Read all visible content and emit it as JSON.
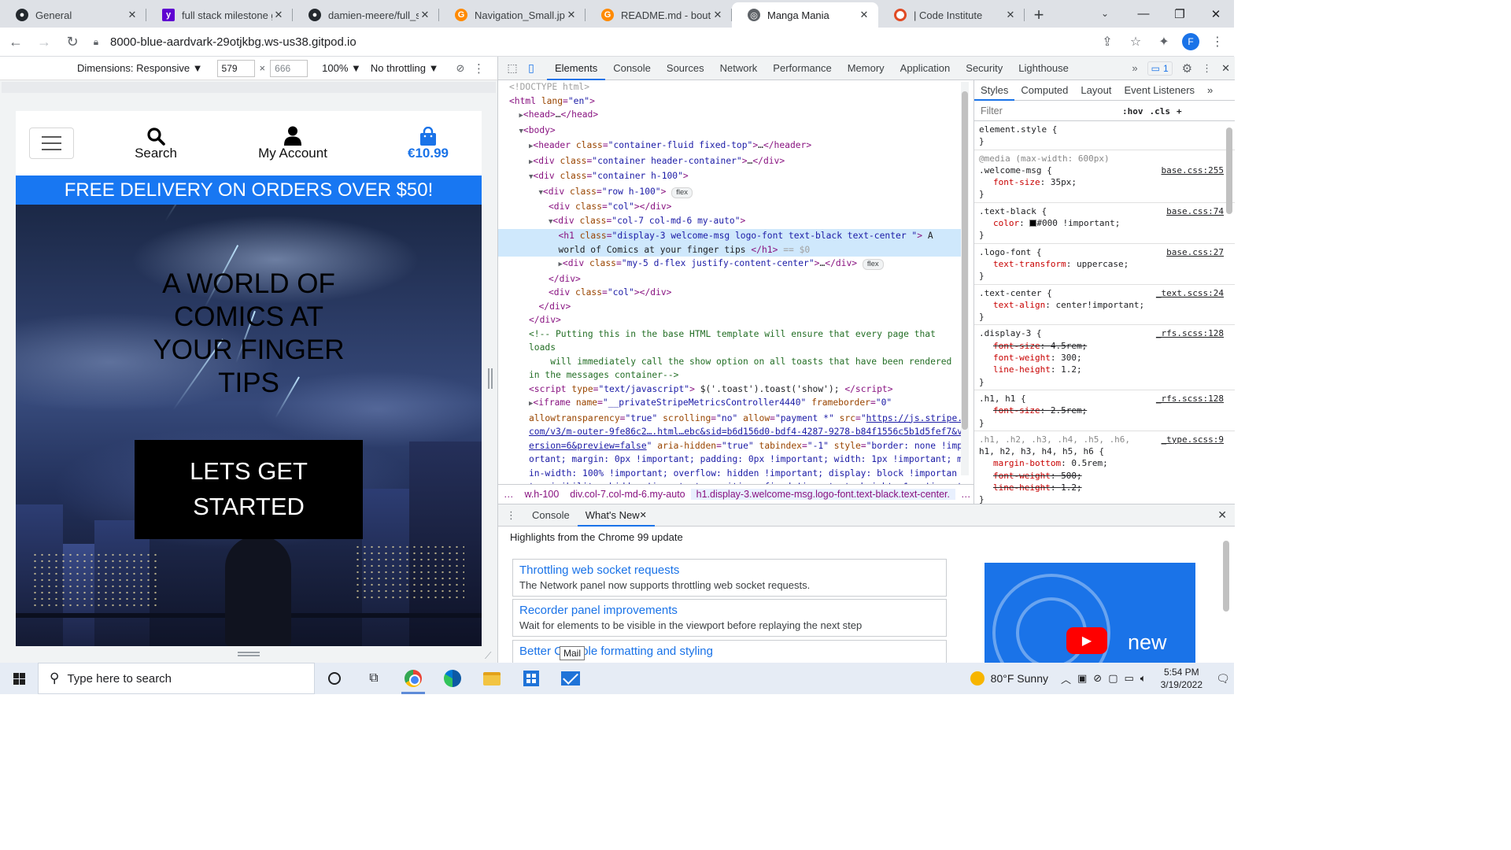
{
  "tabs": [
    {
      "title": "General",
      "favicon": "github-icon",
      "active": false
    },
    {
      "title": "full stack milestone gi",
      "favicon": "yahoo-icon",
      "active": false
    },
    {
      "title": "damien-meere/full_st",
      "favicon": "github-icon",
      "active": false
    },
    {
      "title": "Navigation_Small.jpg",
      "favicon": "gitpod-icon",
      "active": false
    },
    {
      "title": "README.md - boutiq",
      "favicon": "gitpod-icon",
      "active": false
    },
    {
      "title": "Manga Mania",
      "favicon": "globe-icon",
      "active": true
    },
    {
      "title": "| Code Institute",
      "favicon": "code-institute-icon",
      "active": false
    }
  ],
  "window_controls": {
    "minimize": "—",
    "maximize": "❐",
    "close": "✕"
  },
  "omnibox": {
    "url": "8000-blue-aardvark-29otjkbg.ws-us38.gitpod.io",
    "profile_initial": "F"
  },
  "device_toolbar": {
    "dimensions_label": "Dimensions: Responsive ▼",
    "width": "579",
    "height": "666",
    "zoom": "100% ▼",
    "throttling": "No throttling ▼"
  },
  "site": {
    "nav": {
      "search_label": "Search",
      "account_label": "My Account",
      "bag_total": "€10.99"
    },
    "banner": "FREE DELIVERY ON ORDERS OVER $50!",
    "hero_title": "A WORLD OF COMICS AT YOUR FINGER TIPS",
    "cta_label": "LETS GET STARTED"
  },
  "devtools": {
    "tabs": [
      "Elements",
      "Console",
      "Sources",
      "Network",
      "Performance",
      "Memory",
      "Application",
      "Security",
      "Lighthouse"
    ],
    "active_tab": "Elements",
    "issues_count": "1",
    "elements_lines": [
      {
        "indent": 0,
        "html": "<span class='dim'>&lt;!DOCTYPE html&gt;</span>"
      },
      {
        "indent": 0,
        "html": "<span class='tag'>&lt;html</span> <span class='an'>lang</span>=<span class='av'>\"en\"</span><span class='tag'>&gt;</span>"
      },
      {
        "indent": 1,
        "html": "<span class='tri'>▶</span><span class='tag'>&lt;head&gt;</span><span class='txt'>…</span><span class='tag'>&lt;/head&gt;</span>"
      },
      {
        "indent": 1,
        "html": "<span class='tri'>▼</span><span class='tag'>&lt;body&gt;</span>"
      },
      {
        "indent": 2,
        "html": "<span class='tri'>▶</span><span class='tag'>&lt;header</span> <span class='an'>class</span>=<span class='av'>\"container-fluid fixed-top\"</span><span class='tag'>&gt;</span><span class='txt'>…</span><span class='tag'>&lt;/header&gt;</span>"
      },
      {
        "indent": 2,
        "html": "<span class='tri'>▶</span><span class='tag'>&lt;div</span> <span class='an'>class</span>=<span class='av'>\"container header-container\"</span><span class='tag'>&gt;</span><span class='txt'>…</span><span class='tag'>&lt;/div&gt;</span>"
      },
      {
        "indent": 2,
        "html": "<span class='tri'>▼</span><span class='tag'>&lt;div</span> <span class='an'>class</span>=<span class='av'>\"container h-100\"</span><span class='tag'>&gt;</span>"
      },
      {
        "indent": 3,
        "html": "<span class='tri'>▼</span><span class='tag'>&lt;div</span> <span class='an'>class</span>=<span class='av'>\"row h-100\"</span><span class='tag'>&gt;</span> <span class='badge'>flex</span>"
      },
      {
        "indent": 4,
        "html": "<span class='tag'>&lt;div</span> <span class='an'>class</span>=<span class='av'>\"col\"</span><span class='tag'>&gt;&lt;/div&gt;</span>"
      },
      {
        "indent": 4,
        "html": "<span class='tri'>▼</span><span class='tag'>&lt;div</span> <span class='an'>class</span>=<span class='av'>\"col-7 col-md-6 my-auto\"</span><span class='tag'>&gt;</span>"
      },
      {
        "indent": 5,
        "sel": true,
        "html": "<span class='tag'>&lt;h1</span> <span class='an'>class</span>=<span class='av'>\"display-3 welcome-msg logo-font text-black text-center \"</span><span class='tag'>&gt;</span><span class='txt'> A</span>"
      },
      {
        "indent": 5,
        "sel": true,
        "html": "<span class='txt'>world of Comics at your finger tips </span><span class='tag'>&lt;/h1&gt;</span> <span class='dim'>== $0</span>"
      },
      {
        "indent": 5,
        "html": "<span class='tri'>▶</span><span class='tag'>&lt;div</span> <span class='an'>class</span>=<span class='av'>\"my-5 d-flex justify-content-center\"</span><span class='tag'>&gt;</span><span class='txt'>…</span><span class='tag'>&lt;/div&gt;</span> <span class='badge'>flex</span>"
      },
      {
        "indent": 4,
        "html": "<span class='tag'>&lt;/div&gt;</span>"
      },
      {
        "indent": 4,
        "html": "<span class='tag'>&lt;div</span> <span class='an'>class</span>=<span class='av'>\"col\"</span><span class='tag'>&gt;&lt;/div&gt;</span>"
      },
      {
        "indent": 3,
        "html": "<span class='tag'>&lt;/div&gt;</span>"
      },
      {
        "indent": 2,
        "html": "<span class='tag'>&lt;/div&gt;</span>"
      },
      {
        "indent": 2,
        "html": "<span class='cm'>&lt;!-- Putting this in the base HTML template will ensure that every page that</span>"
      },
      {
        "indent": 2,
        "html": "<span class='cm'>loads</span>"
      },
      {
        "indent": 2,
        "html": "<span class='cm'>    will immediately call the show option on all toasts that have been rendered</span>"
      },
      {
        "indent": 2,
        "html": "<span class='cm'>in the messages container--&gt;</span>"
      },
      {
        "indent": 2,
        "html": "<span class='tag'>&lt;script</span> <span class='an'>type</span>=<span class='av'>\"text/javascript\"</span><span class='tag'>&gt;</span><span class='txt'> $('.toast').toast('show'); </span><span class='tag'>&lt;/script&gt;</span>"
      },
      {
        "indent": 2,
        "html": "<span class='tri'>▶</span><span class='tag'>&lt;iframe</span> <span class='an'>name</span>=<span class='av'>\"__privateStripeMetricsController4440\"</span> <span class='an'>frameborder</span>=<span class='av'>\"0\"</span>"
      },
      {
        "indent": 2,
        "html": "<span class='an'>allowtransparency</span>=<span class='av'>\"true\"</span> <span class='an'>scrolling</span>=<span class='av'>\"no\"</span> <span class='an'>allow</span>=<span class='av'>\"payment *\"</span> <span class='an'>src</span>=<span class='av'>\"</span><span class='link'>https://js.stripe.</span>"
      },
      {
        "indent": 2,
        "html": "<span class='link'>com/v3/m-outer-9fe86c2….html…ebc&amp;sid=b6d156d0-bdf4-4287-9278-b84f1556c5b1d5fef7&amp;v</span>"
      },
      {
        "indent": 2,
        "html": "<span class='link'>ersion=6&amp;preview=false</span><span class='av'>\"</span> <span class='an'>aria-hidden</span>=<span class='av'>\"true\"</span> <span class='an'>tabindex</span>=<span class='av'>\"-1\"</span> <span class='an'>style</span>=<span class='av'>\"border: none !imp</span>"
      },
      {
        "indent": 2,
        "html": "<span class='av'>ortant; margin: 0px !important; padding: 0px !important; width: 1px !important; m</span>"
      },
      {
        "indent": 2,
        "html": "<span class='av'>in-width: 100% !important; overflow: hidden !important; display: block !importan</span>"
      },
      {
        "indent": 2,
        "html": "<span class='av'>t; visibility: hidden !important; position: fixed !important; height: 1px !import</span>"
      },
      {
        "indent": 2,
        "html": "<span class='av'>ant; pointer-events: none !important; user-select: none !important;\"</span><span class='tag'>&gt;</span><span class='txt'>…</span><span class='tag'>&lt;/iframe&gt;</span>"
      }
    ],
    "breadcrumbs": [
      "…",
      "w.h-100",
      "div.col-7.col-md-6.my-auto",
      "h1.display-3.welcome-msg.logo-font.text-black.text-center.",
      "…"
    ],
    "styles_tabs": [
      "Styles",
      "Computed",
      "Layout",
      "Event Listeners"
    ],
    "filter_placeholder": "Filter",
    "filter_tools": [
      ":hov",
      ".cls",
      "+"
    ],
    "rules": [
      {
        "selector": "element.style {",
        "source": "",
        "props": []
      },
      {
        "media": "@media (max-width: 600px)",
        "selector": ".welcome-msg {",
        "source": "base.css:255",
        "props": [
          {
            "n": "font-size",
            "v": "35px;",
            "strike": false
          }
        ]
      },
      {
        "selector": ".text-black {",
        "source": "base.css:74",
        "props": [
          {
            "n": "color",
            "v": "#000 !important;",
            "strike": false,
            "swatch": true
          }
        ]
      },
      {
        "selector": ".logo-font {",
        "source": "base.css:27",
        "props": [
          {
            "n": "text-transform",
            "v": "uppercase;",
            "strike": false
          }
        ]
      },
      {
        "selector": ".text-center {",
        "source": "_text.scss:24",
        "props": [
          {
            "n": "text-align",
            "v": "center!important;",
            "strike": false
          }
        ]
      },
      {
        "selector": ".display-3 {",
        "source": "_rfs.scss:128",
        "props": [
          {
            "n": "font-size",
            "v": "4.5rem;",
            "strike": true
          },
          {
            "n": "font-weight",
            "v": "300;",
            "strike": false
          },
          {
            "n": "line-height",
            "v": "1.2;",
            "strike": false
          }
        ]
      },
      {
        "selector": ".h1, h1 {",
        "source": "_rfs.scss:128",
        "props": [
          {
            "n": "font-size",
            "v": "2.5rem;",
            "strike": true
          }
        ]
      },
      {
        "selector": ".h1, .h2, .h3, .h4, .h5, .h6,",
        "selector2": "h1, h2, h3, h4, h5, h6 {",
        "source": "_type.scss:9",
        "props": [
          {
            "n": "margin-bottom",
            "v": "0.5rem;",
            "strike": false
          },
          {
            "n": "font-weight",
            "v": "500;",
            "strike": true
          },
          {
            "n": "line-height",
            "v": "1.2;",
            "strike": true
          }
        ]
      }
    ],
    "drawer": {
      "tabs": [
        "Console",
        "What's New"
      ],
      "active": "What's New",
      "highlight": "Highlights from the Chrome 99 update",
      "cards": [
        {
          "title": "Throttling web socket requests",
          "desc": "The Network panel now supports throttling web socket requests."
        },
        {
          "title": "Recorder panel improvements",
          "desc": "Wait for elements to be visible in the viewport before replaying the next step"
        },
        {
          "title": "Better Console formatting and styling",
          "desc": ""
        }
      ],
      "promo_label": "new"
    },
    "tooltip": "Mail"
  },
  "taskbar": {
    "search_placeholder": "Type here to search",
    "weather": "80°F  Sunny",
    "time": "5:54 PM",
    "date": "3/19/2022"
  }
}
